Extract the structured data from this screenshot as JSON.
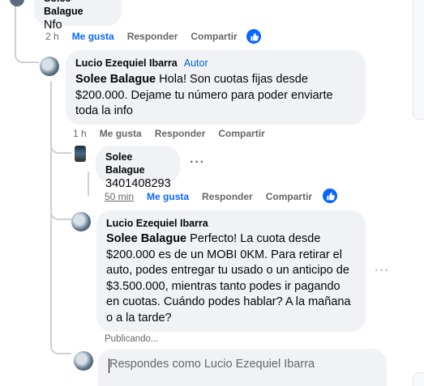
{
  "comments": [
    {
      "author": "Solee Balague",
      "text": "Nfo",
      "time": "2 h",
      "like_label": "Me gusta",
      "reply_label": "Responder",
      "share_label": "Compartir",
      "liked": true
    },
    {
      "author": "Lucio Ezequiel Ibarra",
      "badge": "Autor",
      "mention": "Solee Balague",
      "text": "Hola! Son cuotas fijas desde $200.000. Dejame tu número para poder enviarte toda la info",
      "time": "1 h",
      "like_label": "Me gusta",
      "reply_label": "Responder",
      "share_label": "Compartir"
    },
    {
      "author": "Solee Balague",
      "text": "3401408293",
      "time": "50 min",
      "like_label": "Me gusta",
      "reply_label": "Responder",
      "share_label": "Compartir",
      "liked": true
    },
    {
      "author": "Lucio Ezequiel Ibarra",
      "mention": "Solee Balague",
      "text": "Perfecto! La cuota desde $200.000 es de un MOBI 0KM. Para retirar el auto, podes entregar tu usado o un anticipo de $3.500.000, mientras tanto podes ir pagando en cuotas. Cuándo podes hablar? A la mañana o a la tarde?",
      "status": "Publicando..."
    }
  ],
  "reply_box": {
    "placeholder": "Respondes como Lucio Ezequiel Ibarra"
  },
  "colors": {
    "accent": "#0866ff",
    "bubble": "#f0f2f5",
    "muted": "#65676b",
    "author_badge": "#0064d1"
  },
  "icons": [
    "like-thumb-icon",
    "more-options-icon"
  ]
}
